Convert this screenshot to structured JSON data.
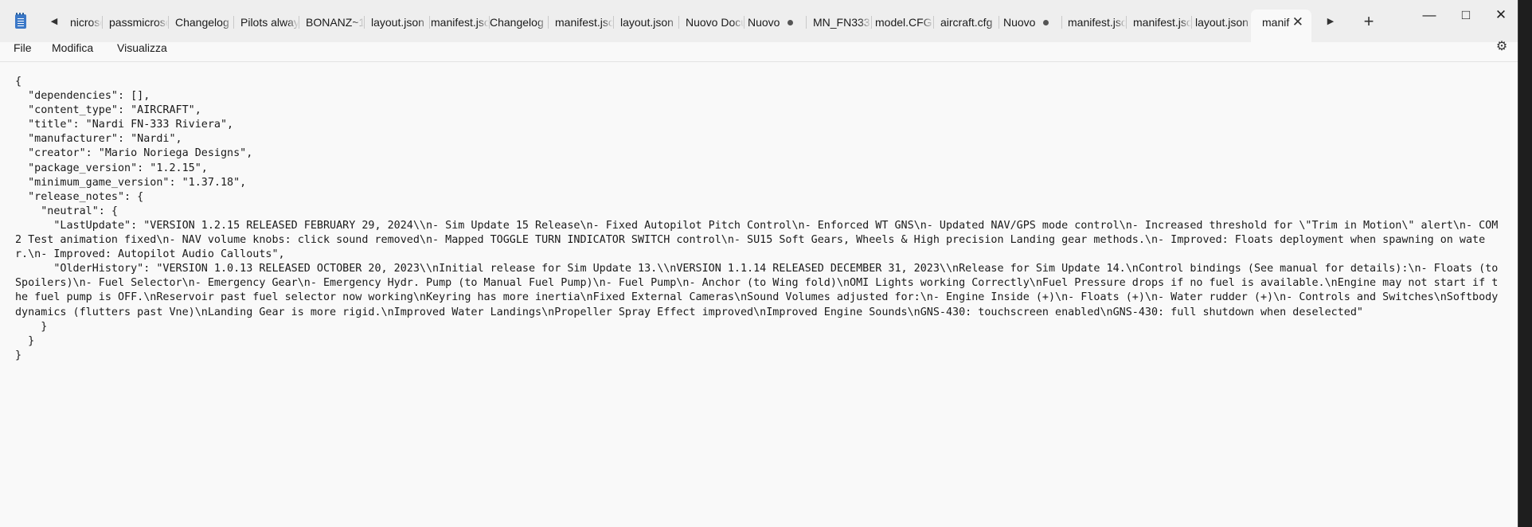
{
  "tabbar": {
    "tabs": [
      {
        "label": "nicroso"
      },
      {
        "label": "passmicroso"
      },
      {
        "label": "Changelog 1"
      },
      {
        "label": "Pilots always"
      },
      {
        "label": "BONANZ~1.("
      },
      {
        "label": "layout.json"
      },
      {
        "label": "manifest.jsoi"
      },
      {
        "label": "Changelog 1"
      },
      {
        "label": "manifest.jsoi"
      },
      {
        "label": "layout.json"
      },
      {
        "label": "Nuovo Docu"
      },
      {
        "label": "Nuovo"
      },
      {
        "label": "MN_FN333_I"
      },
      {
        "label": "model.CFG"
      },
      {
        "label": "aircraft.cfg"
      },
      {
        "label": "Nuovo"
      },
      {
        "label": "manifest.jsoi"
      },
      {
        "label": "manifest.jsoi"
      },
      {
        "label": "layout.json"
      },
      {
        "label": "manif"
      }
    ]
  },
  "menubar": {
    "items": [
      "File",
      "Modifica",
      "Visualizza"
    ]
  },
  "editor": {
    "lines": [
      "{",
      "  \"dependencies\": [],",
      "  \"content_type\": \"AIRCRAFT\",",
      "  \"title\": \"Nardi FN-333 Riviera\",",
      "  \"manufacturer\": \"Nardi\",",
      "  \"creator\": \"Mario Noriega Designs\",",
      "  \"package_version\": \"1.2.15\",",
      "  \"minimum_game_version\": \"1.37.18\",",
      "  \"release_notes\": {",
      "    \"neutral\": {",
      "      \"LastUpdate\": \"VERSION 1.2.15 RELEASED FEBRUARY 29, 2024\\\\n- Sim Update 15 Release\\n- Fixed Autopilot Pitch Control\\n- Enforced WT GNS\\n- Updated NAV/GPS mode control\\n- Increased threshold for \\\"Trim in Motion\\\" alert\\n- COM 2 Test animation fixed\\n- NAV volume knobs: click sound removed\\n- Mapped TOGGLE TURN INDICATOR SWITCH control\\n- SU15 Soft Gears, Wheels & High precision Landing gear methods.\\n- Improved: Floats deployment when spawning on water.\\n- Improved: Autopilot Audio Callouts\",",
      "      \"OlderHistory\": \"VERSION 1.0.13 RELEASED OCTOBER 20, 2023\\\\nInitial release for Sim Update 13.\\\\nVERSION 1.1.14 RELEASED DECEMBER 31, 2023\\\\nRelease for Sim Update 14.\\nControl bindings (See manual for details):\\n- Floats (to Spoilers)\\n- Fuel Selector\\n- Emergency Gear\\n- Emergency Hydr. Pump (to Manual Fuel Pump)\\n- Fuel Pump\\n- Anchor (to Wing fold)\\nOMI Lights working Correctly\\nFuel Pressure drops if no fuel is available.\\nEngine may not start if the fuel pump is OFF.\\nReservoir past fuel selector now working\\nKeyring has more inertia\\nFixed External Cameras\\nSound Volumes adjusted for:\\n- Engine Inside (+)\\n- Floats (+)\\n- Water rudder (+)\\n- Controls and Switches\\nSoftbody dynamics (flutters past Vne)\\nLanding Gear is more rigid.\\nImproved Water Landings\\nPropeller Spray Effect improved\\nImproved Engine Sounds\\nGNS-430: touchscreen enabled\\nGNS-430: full shutdown when deselected\"",
      "    }",
      "  }",
      "}"
    ]
  }
}
